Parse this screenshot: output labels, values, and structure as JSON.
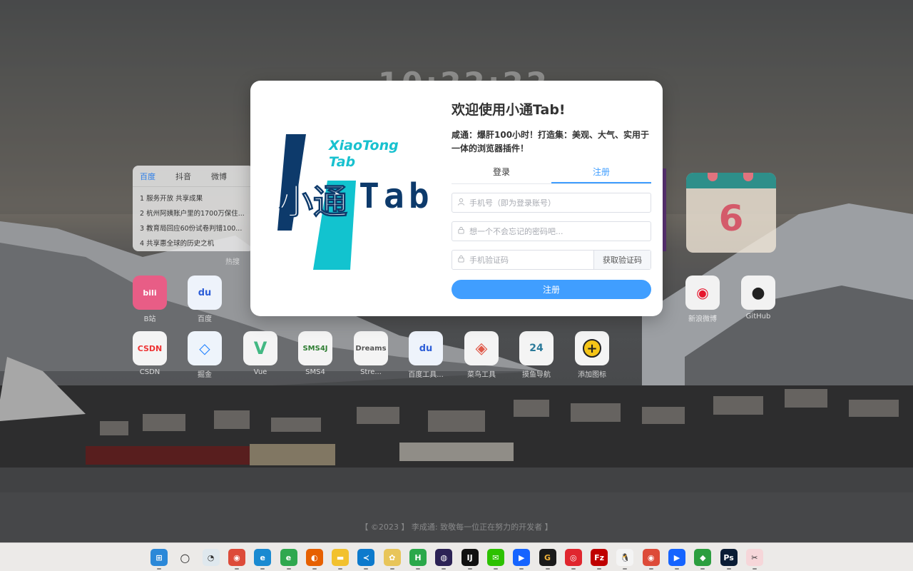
{
  "clock": "10:22:22",
  "hot_search": {
    "tabs": [
      "百度",
      "抖音",
      "微博"
    ],
    "items": [
      "1 服务开放 共享成果",
      "2 杭州阿姨账户里的1700万保住...",
      "3 教育局回应60份试卷判错100...",
      "4 共享惠全球的历史之机"
    ],
    "caption": "热搜"
  },
  "calendar": {
    "day": "6"
  },
  "apps_row1": [
    {
      "label": "B站",
      "icon": "bilibili-icon",
      "color": "#e85d86",
      "glyph": "bili"
    },
    {
      "label": "百度",
      "icon": "baidu-icon",
      "color": "#eef3fb",
      "glyph": "du"
    },
    {
      "label": "新浪微博",
      "icon": "weibo-icon",
      "color": "#f2f2f2",
      "glyph": "微"
    },
    {
      "label": "GitHub",
      "icon": "github-icon",
      "color": "#f2f2f2",
      "glyph": "GH"
    }
  ],
  "apps_row2": [
    {
      "label": "CSDN",
      "icon": "csdn-icon",
      "color": "#f4f4f4",
      "glyph": "CSDN"
    },
    {
      "label": "掘金",
      "icon": "juejin-icon",
      "color": "#eef4fb",
      "glyph": "掘"
    },
    {
      "label": "Vue",
      "icon": "vue-icon",
      "color": "#f4f4f4",
      "glyph": "V"
    },
    {
      "label": "SMS4",
      "icon": "sms4j-icon",
      "color": "#f4f4f4",
      "glyph": "SMS4J"
    },
    {
      "label": "Stre...",
      "icon": "dreams-icon",
      "color": "#f4f4f4",
      "glyph": "D"
    },
    {
      "label": "百度工具...",
      "icon": "baidu-tools-icon",
      "color": "#eef3fb",
      "glyph": "du"
    },
    {
      "label": "菜鸟工具",
      "icon": "runoob-icon",
      "color": "#f4f4f4",
      "glyph": "◈"
    },
    {
      "label": "摸鱼导航",
      "icon": "calendar-nav-icon",
      "color": "#f4f4f4",
      "glyph": "24"
    },
    {
      "label": "添加图标",
      "icon": "add-icon",
      "color": "#f4f4f4",
      "glyph": "+"
    }
  ],
  "footer": "【 ©2023 】 李成通: 致敬每一位正在努力的开发者 】",
  "dialog": {
    "logo_top": "XiaoTong",
    "logo_sub": "Tab",
    "logo_main_cn": "小通",
    "logo_main_en": "Tab",
    "title": "欢迎使用小通Tab!",
    "subtitle": "咸通：爆肝100小时！打造集：美观、大气、实用于一体的浏览器插件！",
    "tab_login": "登录",
    "tab_register": "注册",
    "active_tab": "注册",
    "phone_placeholder": "手机号（即为登录账号）",
    "password_placeholder": "想一个不会忘记的密码吧...",
    "code_placeholder": "手机验证码",
    "get_code_label": "获取验证码",
    "submit_label": "注册"
  },
  "taskbar": [
    {
      "name": "windows-start-icon",
      "color": "#2b88d8",
      "glyph": "⊞"
    },
    {
      "name": "search-icon",
      "color": "transparent",
      "glyph": "○"
    },
    {
      "name": "widget-icon",
      "color": "#dfe8ee",
      "glyph": "◔"
    },
    {
      "name": "chrome-icon",
      "color": "#dd4b39",
      "glyph": "◉"
    },
    {
      "name": "edge-icon",
      "color": "#1a8ad1",
      "glyph": "e"
    },
    {
      "name": "ie-icon",
      "color": "#2fa84f",
      "glyph": "e"
    },
    {
      "name": "firefox-icon",
      "color": "#e66000",
      "glyph": "◐"
    },
    {
      "name": "file-explorer-icon",
      "color": "#f2c12e",
      "glyph": "▬"
    },
    {
      "name": "vscode-icon",
      "color": "#0d7acc",
      "glyph": "≺"
    },
    {
      "name": "app-gold-icon",
      "color": "#e8c55a",
      "glyph": "✿"
    },
    {
      "name": "hbuilder-icon",
      "color": "#2aa84a",
      "glyph": "H"
    },
    {
      "name": "eclipse-icon",
      "color": "#2c2255",
      "glyph": "◍"
    },
    {
      "name": "intellij-icon",
      "color": "#111111",
      "glyph": "IJ"
    },
    {
      "name": "wechat-icon",
      "color": "#2dc100",
      "glyph": "✉"
    },
    {
      "name": "feishu-icon",
      "color": "#1664ff",
      "glyph": "▶"
    },
    {
      "name": "gold-g-icon",
      "color": "#1a1a1a",
      "glyph": "G"
    },
    {
      "name": "netease-music-icon",
      "color": "#e0262e",
      "glyph": "◎"
    },
    {
      "name": "filezilla-icon",
      "color": "#bf0000",
      "glyph": "Fz"
    },
    {
      "name": "qq-icon",
      "color": "#f4f4f4",
      "glyph": "🐧"
    },
    {
      "name": "chrome2-icon",
      "color": "#dd4b39",
      "glyph": "◉"
    },
    {
      "name": "feishu2-icon",
      "color": "#1664ff",
      "glyph": "▶"
    },
    {
      "name": "dingtalk-icon",
      "color": "#2c9e3f",
      "glyph": "◆"
    },
    {
      "name": "photoshop-icon",
      "color": "#0a1c35",
      "glyph": "Ps"
    },
    {
      "name": "snipping-tool-icon",
      "color": "#f6d6d9",
      "glyph": "✂"
    }
  ]
}
